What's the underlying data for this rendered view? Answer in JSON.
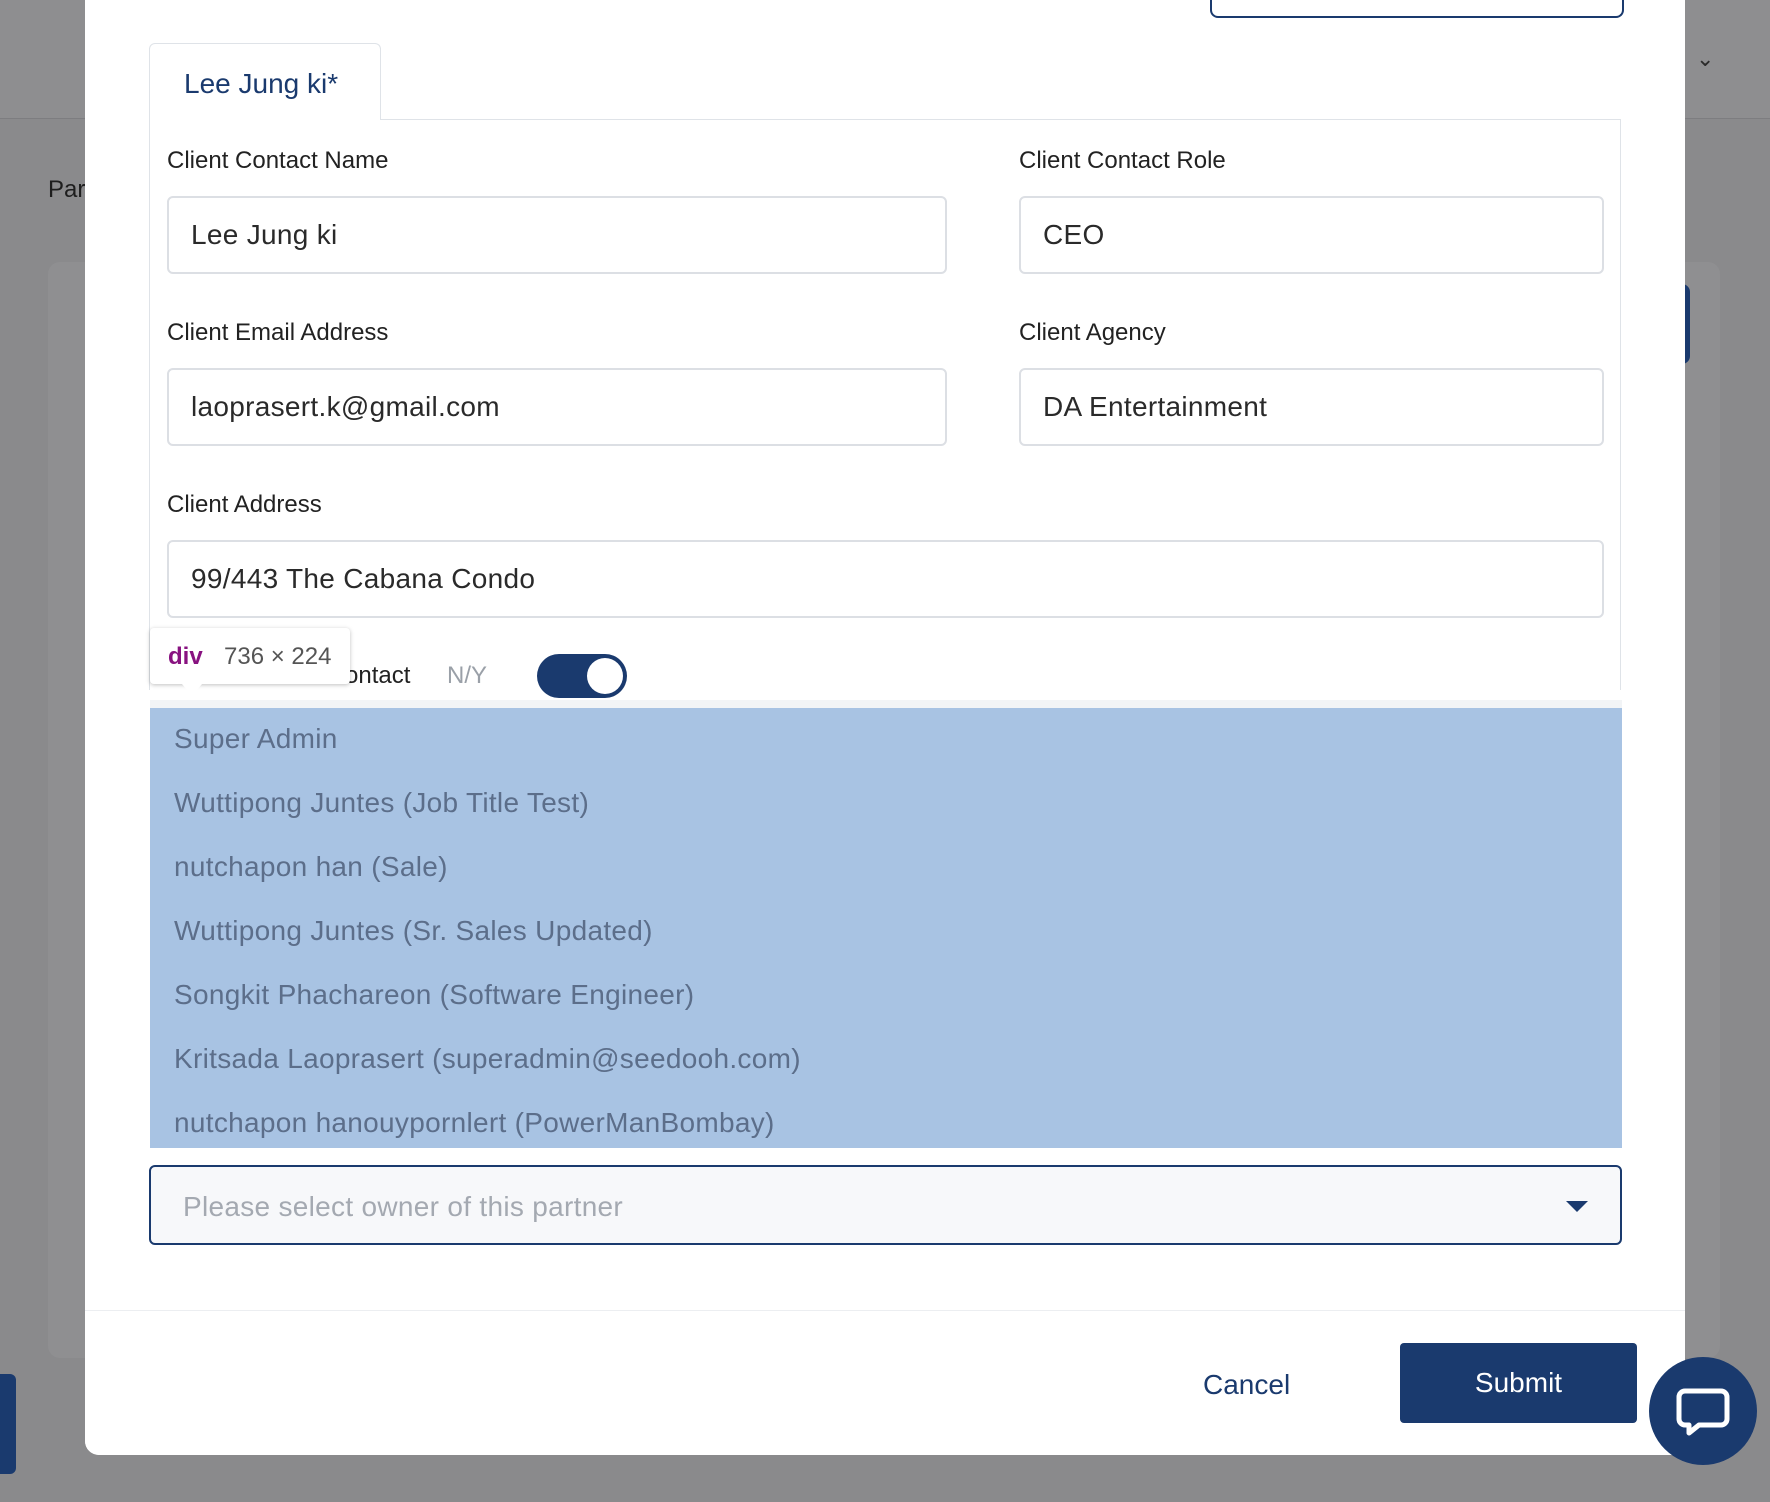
{
  "background": {
    "page_label_fragment": "Par"
  },
  "tab": {
    "label": "Lee Jung ki*"
  },
  "form": {
    "contact_name_label": "Client Contact Name",
    "contact_name_value": "Lee Jung ki",
    "contact_role_label": "Client Contact Role",
    "contact_role_value": "CEO",
    "email_label": "Client Email Address",
    "email_value": "laoprasert.k@gmail.com",
    "agency_label": "Client Agency",
    "agency_value": "DA Entertainment",
    "address_label": "Client Address",
    "address_value": "99/443 The Cabana Condo",
    "primary_contact_label_fragment": "ontact",
    "primary_contact_ny": "N/Y",
    "primary_contact_on": true
  },
  "dropdown": {
    "options": [
      "Super Admin",
      "Wuttipong Juntes (Job Title Test)",
      "nutchapon han (Sale)",
      "Wuttipong Juntes (Sr. Sales Updated)",
      "Songkit Phachareon (Software Engineer)",
      "Kritsada Laoprasert (superadmin@seedooh.com)",
      "nutchapon hanouypornlert (PowerManBombay)"
    ]
  },
  "owner_select": {
    "placeholder": "Please select owner of this partner"
  },
  "footer": {
    "cancel_label": "Cancel",
    "submit_label": "Submit"
  },
  "devtools_tooltip": {
    "tag": "div",
    "size": "736 × 224"
  },
  "colors": {
    "primary": "#1a3a6e",
    "highlight": "#a8c3e3",
    "overlay": "#8a8a8c"
  },
  "icons": {
    "chat": "chat-bubble-icon",
    "caret": "caret-down-icon",
    "chevron": "chevron-down-icon"
  }
}
